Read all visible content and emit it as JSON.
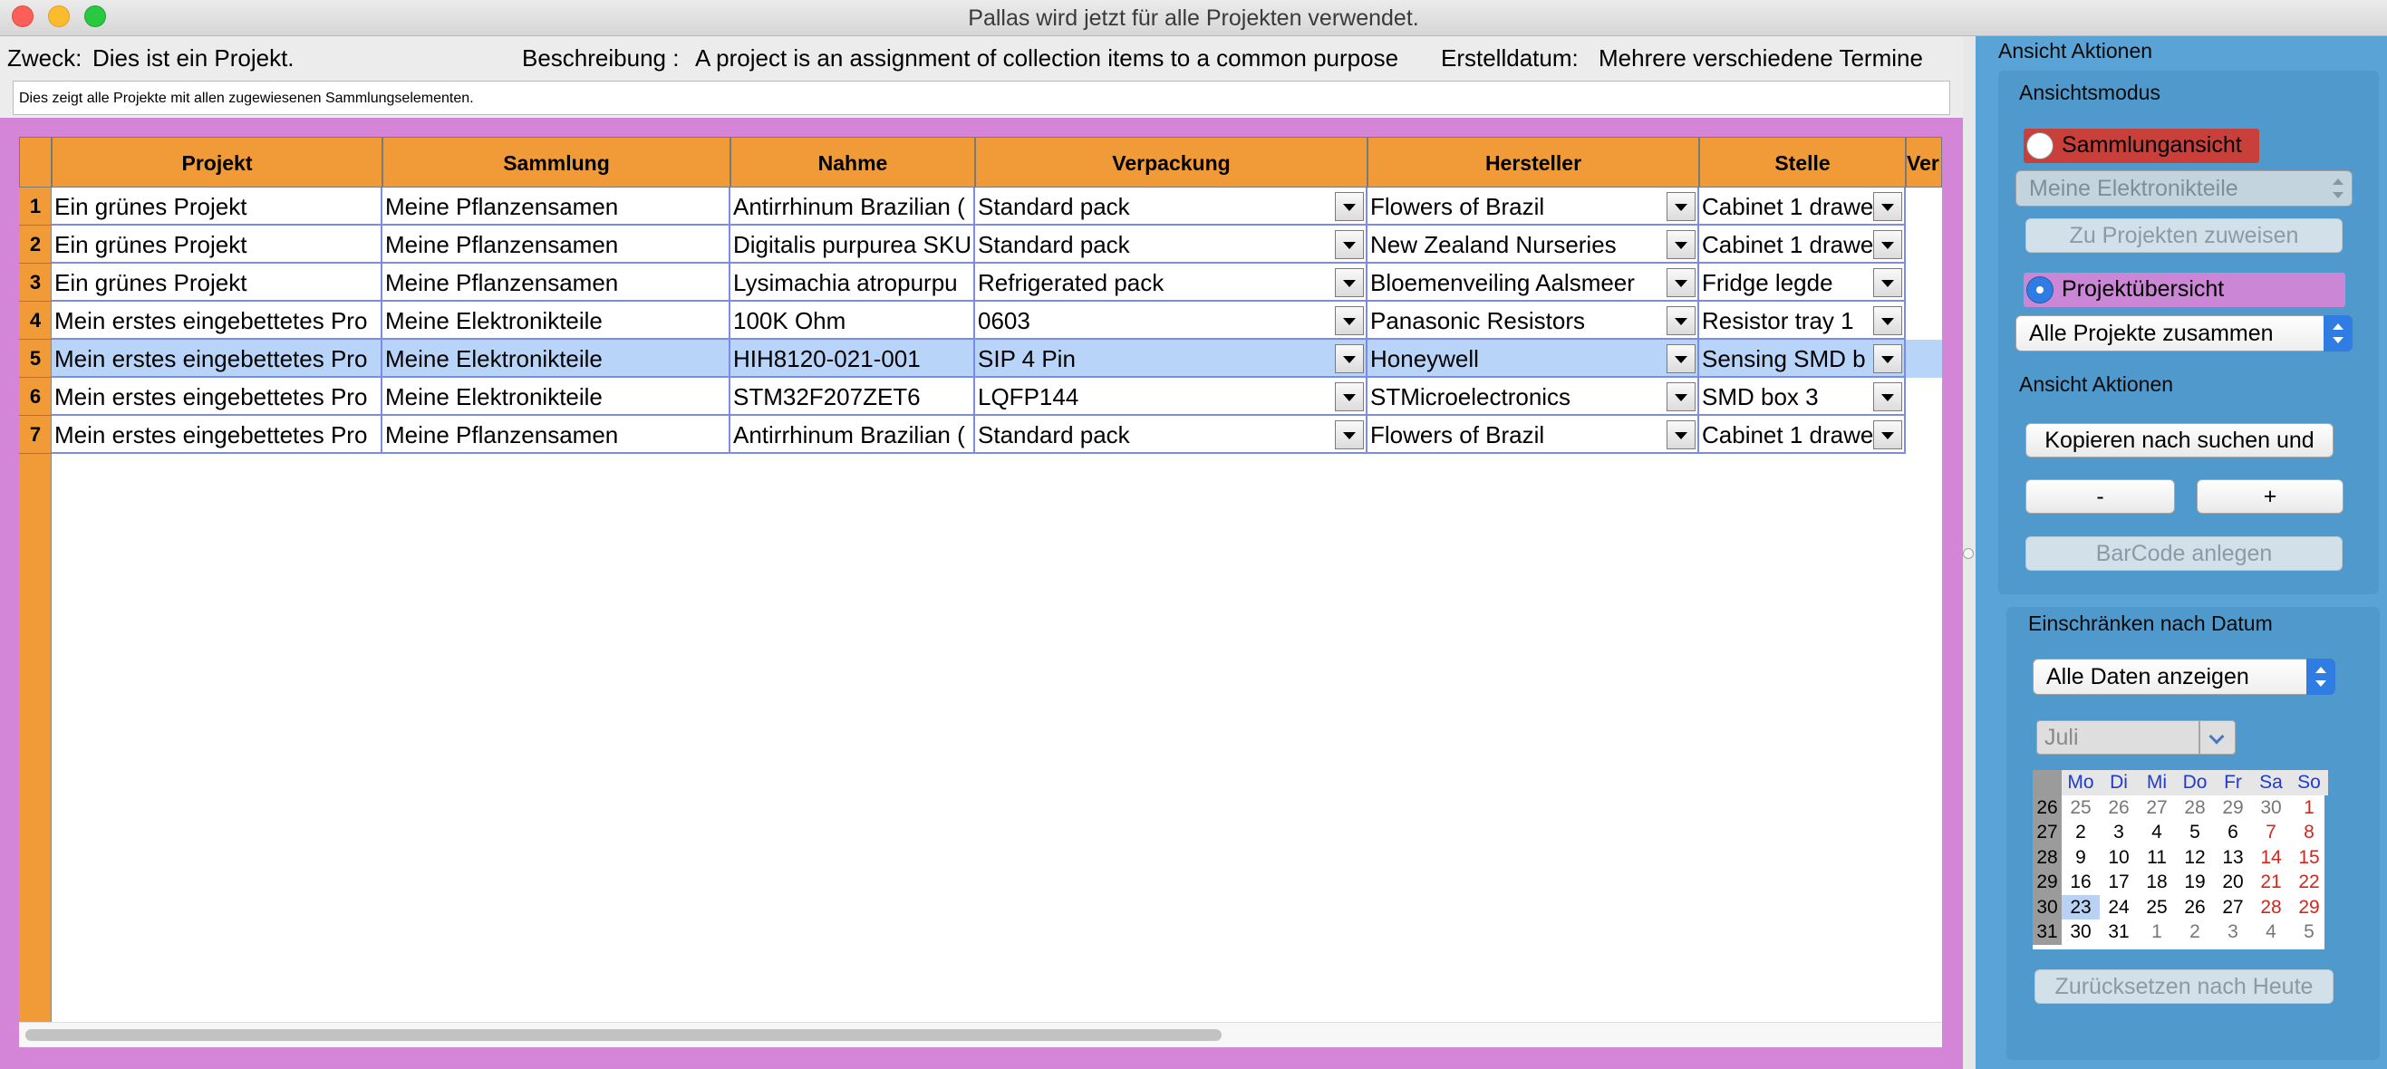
{
  "window": {
    "title": "Pallas wird jetzt für alle Projekten verwendet."
  },
  "info": {
    "purpose_label": "Zweck:",
    "purpose_value": "Dies ist ein Projekt.",
    "description_label": "Beschreibung :",
    "description_value": "A project is an assignment of collection items to a common purpose",
    "created_label": "Erstelldatum:",
    "created_value": "Mehrere verschiedene Termine",
    "subinfo": "Dies zeigt alle Projekte mit allen zugewiesenen Sammlungselementen."
  },
  "table": {
    "columns": [
      "Projekt",
      "Sammlung",
      "Nahme",
      "Verpackung",
      "Hersteller",
      "Stelle",
      "Ver"
    ],
    "rows": [
      {
        "num": "1",
        "cells": [
          "Ein grünes Projekt",
          "Meine Pflanzensamen",
          "Antirrhinum Brazilian (",
          "Standard pack",
          "Flowers of Brazil",
          "Cabinet 1 drawe"
        ]
      },
      {
        "num": "2",
        "cells": [
          "Ein grünes Projekt",
          "Meine Pflanzensamen",
          "Digitalis purpurea SKU",
          "Standard pack",
          "New Zealand Nurseries",
          "Cabinet 1 drawe"
        ]
      },
      {
        "num": "3",
        "cells": [
          "Ein grünes Projekt",
          "Meine Pflanzensamen",
          "Lysimachia atropurpu",
          "Refrigerated pack",
          "Bloemenveiling Aalsmeer",
          "Fridge legde"
        ]
      },
      {
        "num": "4",
        "cells": [
          "Mein erstes eingebettetes Pro",
          "Meine Elektronikteile",
          "100K Ohm",
          "0603",
          "Panasonic Resistors",
          "Resistor tray 1"
        ]
      },
      {
        "num": "5",
        "cells": [
          "Mein erstes eingebettetes Pro",
          "Meine Elektronikteile",
          "HIH8120-021-001",
          "SIP 4 Pin",
          "Honeywell",
          "Sensing SMD b"
        ]
      },
      {
        "num": "6",
        "cells": [
          "Mein erstes eingebettetes Pro",
          "Meine Elektronikteile",
          "STM32F207ZET6",
          "LQFP144",
          "STMicroelectronics",
          "SMD box 3"
        ]
      },
      {
        "num": "7",
        "cells": [
          "Mein erstes eingebettetes Pro",
          "Meine Pflanzensamen",
          "Antirrhinum Brazilian (",
          "Standard pack",
          "Flowers of Brazil",
          "Cabinet 1 drawe"
        ]
      }
    ],
    "selected_row": 5
  },
  "sidebar": {
    "title": "Ansicht Aktionen",
    "mode_label": "Ansichtsmodus",
    "radio_collection": "Sammlungansicht",
    "collection_popup": "Meine Elektronikteile",
    "assign_button": "Zu Projekten zuweisen",
    "radio_project": "Projektübersicht",
    "project_popup": "Alle Projekte zusammen",
    "actions_label": "Ansicht Aktionen",
    "copy_button": "Kopieren nach suchen und",
    "minus_button": "-",
    "plus_button": "+",
    "barcode_button": "BarCode anlegen",
    "date_label": "Einschränken nach Datum",
    "date_popup": "Alle Daten anzeigen",
    "month_popup": "Juli",
    "reset_button": "Zurücksetzen nach Heute"
  },
  "calendar": {
    "weekdays": [
      "Mo",
      "Di",
      "Mi",
      "Do",
      "Fr",
      "Sa",
      "So"
    ],
    "weeks": [
      {
        "week": "26",
        "days": [
          "25",
          "26",
          "27",
          "28",
          "29",
          "30",
          "1"
        ]
      },
      {
        "week": "27",
        "days": [
          "2",
          "3",
          "4",
          "5",
          "6",
          "7",
          "8"
        ]
      },
      {
        "week": "28",
        "days": [
          "9",
          "10",
          "11",
          "12",
          "13",
          "14",
          "15"
        ]
      },
      {
        "week": "29",
        "days": [
          "16",
          "17",
          "18",
          "19",
          "20",
          "21",
          "22"
        ]
      },
      {
        "week": "30",
        "days": [
          "23",
          "24",
          "25",
          "26",
          "27",
          "28",
          "29"
        ]
      },
      {
        "week": "31",
        "days": [
          "30",
          "31",
          "1",
          "2",
          "3",
          "4",
          "5"
        ]
      }
    ],
    "today": "23"
  },
  "colors": {
    "grid_header": "#f19a38",
    "grid_frame": "#d585d8",
    "sidebar": "#5aa3d6",
    "selected_row": "#b8d4f8",
    "radio_collection_bg": "#c9403a",
    "radio_project_bg": "#cc86d6"
  }
}
